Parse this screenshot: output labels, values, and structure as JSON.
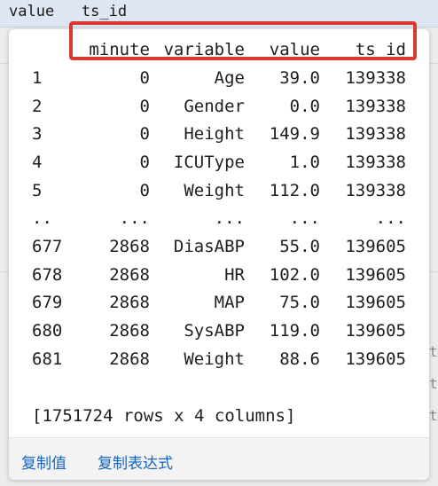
{
  "background": {
    "header_text": "value   ts_id",
    "right_glyphs": [
      "t",
      "t",
      "t"
    ]
  },
  "table": {
    "headers": [
      "",
      "minute",
      "variable",
      "value",
      "ts_id"
    ],
    "rows": [
      [
        "1",
        "0",
        "Age",
        "39.0",
        "139338"
      ],
      [
        "2",
        "0",
        "Gender",
        "0.0",
        "139338"
      ],
      [
        "3",
        "0",
        "Height",
        "149.9",
        "139338"
      ],
      [
        "4",
        "0",
        "ICUType",
        "1.0",
        "139338"
      ],
      [
        "5",
        "0",
        "Weight",
        "112.0",
        "139338"
      ],
      [
        "..",
        "...",
        "...",
        "...",
        "..."
      ],
      [
        "677",
        "2868",
        "DiasABP",
        "55.0",
        "139605"
      ],
      [
        "678",
        "2868",
        "HR",
        "102.0",
        "139605"
      ],
      [
        "679",
        "2868",
        "MAP",
        "75.0",
        "139605"
      ],
      [
        "680",
        "2868",
        "SysABP",
        "119.0",
        "139605"
      ],
      [
        "681",
        "2868",
        "Weight",
        "88.6",
        "139605"
      ]
    ],
    "summary": "[1751724 rows x 4 columns]"
  },
  "footer": {
    "copy_value": "复制值",
    "copy_expression": "复制表达式"
  },
  "colors": {
    "highlight": "#d63a2e",
    "link": "#1565c0"
  }
}
